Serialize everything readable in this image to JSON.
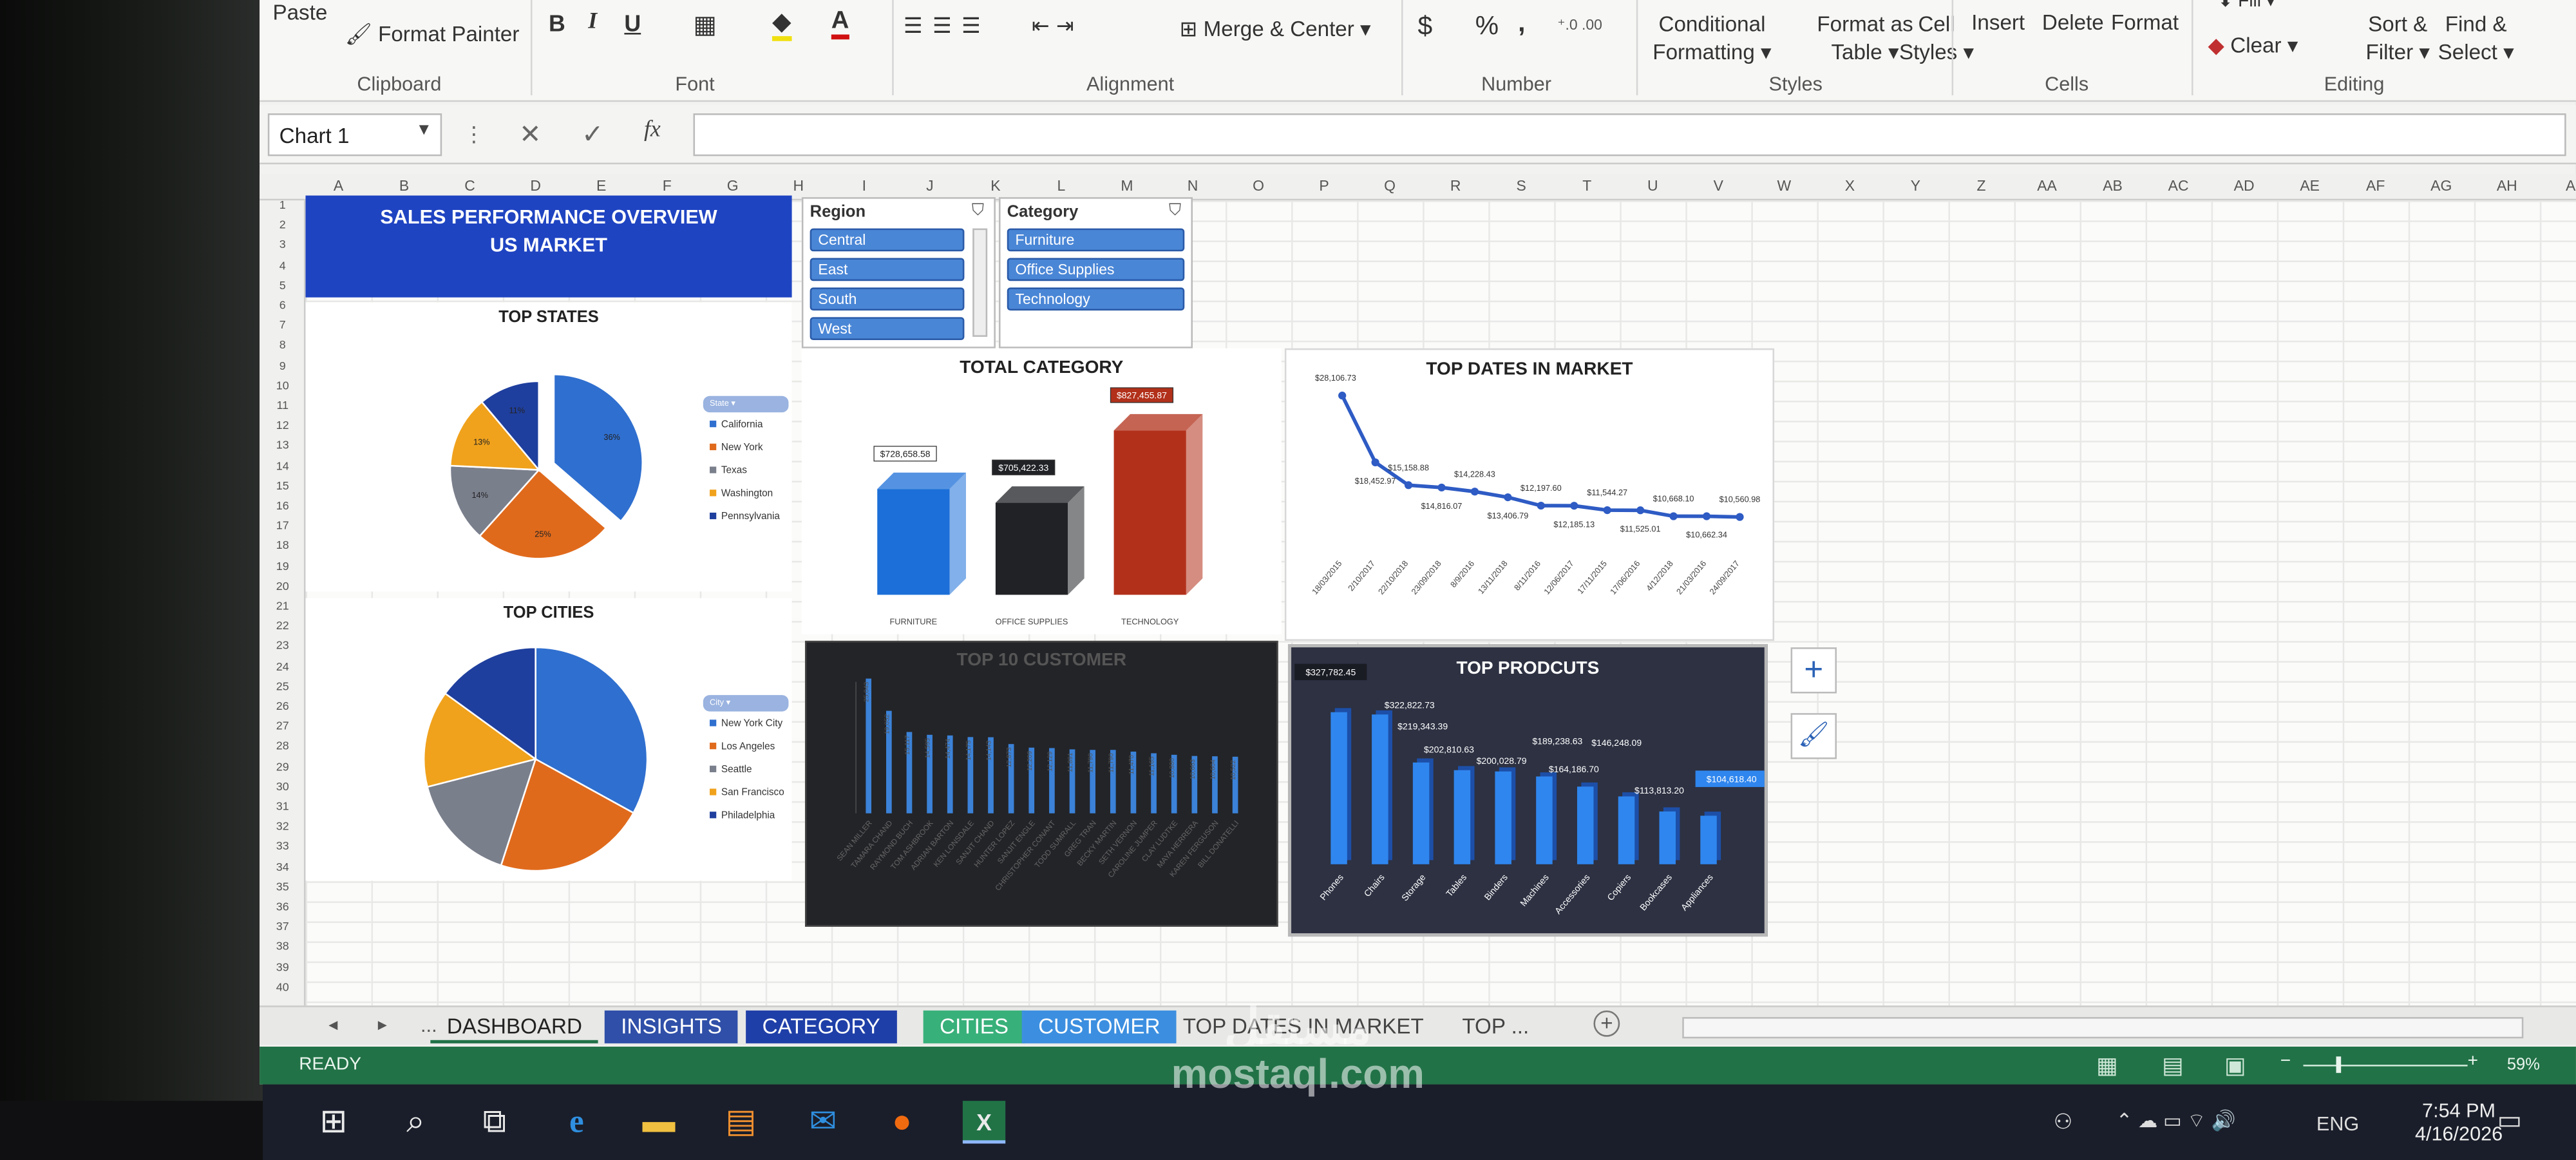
{
  "ribbon": {
    "paste": "Paste",
    "format_painter": "Format Painter",
    "clipboard": "Clipboard",
    "bold": "B",
    "italic": "I",
    "underline": "U",
    "font": "Font",
    "alignment": "Alignment",
    "merge_center": "Merge & Center",
    "currency": "$",
    "percent": "%",
    "comma": ",",
    "number": "Number",
    "cond_format_1": "Conditional",
    "cond_format_2": "Formatting",
    "format_table_1": "Format as",
    "format_table_2": "Table",
    "cell_styles_1": "Cell",
    "cell_styles_2": "Styles",
    "styles": "Styles",
    "insert": "Insert",
    "delete": "Delete",
    "format": "Format",
    "cells": "Cells",
    "fill": "Fill",
    "clear": "Clear",
    "sort_1": "Sort &",
    "sort_2": "Filter",
    "find_1": "Find &",
    "find_2": "Select",
    "editing": "Editing"
  },
  "formula_bar": {
    "name_box": "Chart 1",
    "fx": "fx"
  },
  "columns": [
    "A",
    "B",
    "C",
    "D",
    "E",
    "F",
    "G",
    "H",
    "I",
    "J",
    "K",
    "L",
    "M",
    "N",
    "O",
    "P",
    "Q",
    "R",
    "S",
    "T",
    "U",
    "V",
    "W",
    "X",
    "Y",
    "Z",
    "AA",
    "AB",
    "AC",
    "AD",
    "AE",
    "AF",
    "AG",
    "AH",
    "AI"
  ],
  "rows": [
    "1",
    "2",
    "3",
    "4",
    "5",
    "6",
    "7",
    "8",
    "9",
    "10",
    "11",
    "12",
    "13",
    "14",
    "15",
    "16",
    "17",
    "18",
    "19",
    "20",
    "21",
    "22",
    "23",
    "24",
    "25",
    "26",
    "27",
    "28",
    "29",
    "30",
    "31",
    "32",
    "33",
    "34",
    "35",
    "36",
    "37",
    "38",
    "39",
    "40"
  ],
  "dashboard": {
    "title_1": "SALES PERFORMANCE OVERVIEW",
    "title_2": "US MARKET",
    "region_slicer": {
      "title": "Region",
      "items": [
        "Central",
        "East",
        "South",
        "West"
      ]
    },
    "category_slicer": {
      "title": "Category",
      "items": [
        "Furniture",
        "Office Supplies",
        "Technology"
      ]
    },
    "states_legend_title": "State",
    "cities_legend_title": "City"
  },
  "chart_data": [
    {
      "id": "top-states",
      "type": "pie",
      "title": "TOP STATES",
      "categories": [
        "California",
        "New York",
        "Texas",
        "Washington",
        "Pennsylvania"
      ],
      "values": [
        36,
        25,
        14,
        13,
        11
      ],
      "data_labels": [
        "36%",
        "25%",
        "14%",
        "13%",
        "11%"
      ],
      "colors": [
        "#2f6fcf",
        "#e06a1c",
        "#7a7f8c",
        "#f0a21c",
        "#1f3f9e"
      ]
    },
    {
      "id": "top-cities",
      "type": "pie",
      "title": "TOP CITIES",
      "categories": [
        "New York City",
        "Los Angeles",
        "Seattle",
        "San Francisco",
        "Philadelphia"
      ],
      "values": [
        33,
        22,
        16,
        14,
        15
      ],
      "colors": [
        "#2f6fcf",
        "#e06a1c",
        "#7a7f8c",
        "#f0a21c",
        "#1f3f9e"
      ]
    },
    {
      "id": "total-category",
      "type": "bar",
      "title": "TOTAL CATEGORY",
      "categories": [
        "FURNITURE",
        "OFFICE SUPPLIES",
        "TECHNOLOGY"
      ],
      "values": [
        728658.58,
        705422.33,
        827455.87
      ],
      "data_labels": [
        "$728,658.58",
        "$705,422.33",
        "$827,455.87"
      ],
      "colors": [
        "#1c6fd8",
        "#202226",
        "#b2301a"
      ]
    },
    {
      "id": "top-dates",
      "type": "line",
      "title": "TOP DATES IN MARKET",
      "categories": [
        "18/03/2015",
        "2/10/2017",
        "22/10/2018",
        "23/09/2018",
        "8/9/2016",
        "13/11/2018",
        "8/11/2016",
        "12/06/2017",
        "17/11/2015",
        "17/06/2016",
        "4/12/2018",
        "21/03/2016",
        "24/09/2017"
      ],
      "values": [
        28106.73,
        18452.97,
        15158.88,
        14816.07,
        14228.43,
        13406.79,
        12197.6,
        12185.13,
        11544.27,
        11525.01,
        10668.1,
        10662.34,
        10560.98
      ],
      "data_labels": [
        "$28,106.73",
        "$18,452.97",
        "$15,158.88",
        "$14,816.07",
        "$14,228.43",
        "$13,406.79",
        "$12,197.60",
        "$12,185.13",
        "$11,544.27",
        "$11,525.01",
        "$10,668.10",
        "$10,662.34",
        "$10,560.98"
      ]
    },
    {
      "id": "top-customer",
      "type": "bar",
      "title": "TOP 10 CUSTOMER",
      "categories": [
        "SEAN MILLER",
        "TAMARA CHAND",
        "RAYMOND BUCH",
        "TOM ASHBROOK",
        "ADRIAN BARTON",
        "KEN LONSDALE",
        "SANJIT CHAND",
        "HUNTER LOPEZ",
        "SANJIT ENGLE",
        "CHRISTOPHER CONANT",
        "TODD SUMRALL",
        "GREG TRAN",
        "BECKY MARTIN",
        "SETH VERNON",
        "CAROLINE JUMPER",
        "CLAY LUDTKE",
        "MAYA HERRERA",
        "KAREN FERGUSON",
        "BILL DONATELLI"
      ],
      "values": [
        25043,
        19052,
        15117,
        14595,
        14474,
        14175,
        14143,
        12873,
        12209,
        12129,
        11891,
        11790,
        11790,
        11470,
        11165,
        10880,
        10663,
        10604,
        10522
      ]
    },
    {
      "id": "top-products",
      "type": "bar",
      "title": "TOP PRODCUTS",
      "categories": [
        "Phones",
        "Chairs",
        "Storage",
        "Tables",
        "Binders",
        "Machines",
        "Accessories",
        "Copiers",
        "Bookcases",
        "Appliances"
      ],
      "values": [
        327782.45,
        322822.73,
        219343.39,
        202810.63,
        200028.79,
        189238.63,
        167380.32,
        146248.09,
        113813.2,
        104618.4
      ],
      "data_labels": [
        "$327,782.45",
        "$322,822.73",
        "$219,343.39",
        "$202,810.63",
        "$200,028.79",
        "$189,238.63",
        "$164,186.70",
        "$146,248.09",
        "$113,813.20",
        "$104,618.40"
      ]
    }
  ],
  "tabs": [
    {
      "label": "DASHBOARD",
      "bg": "transparent",
      "fg": "#222"
    },
    {
      "label": "INSIGHTS",
      "bg": "#2f4fa8",
      "fg": "#fff"
    },
    {
      "label": "CATEGORY",
      "bg": "#1f3fa8",
      "fg": "#fff"
    },
    {
      "label": "CITIES",
      "bg": "#38b07a",
      "fg": "#fff"
    },
    {
      "label": "CUSTOMER",
      "bg": "#3c8fe0",
      "fg": "#fff"
    },
    {
      "label": "TOP DATES IN MARKET",
      "bg": "transparent",
      "fg": "#444"
    },
    {
      "label": "TOP ...",
      "bg": "transparent",
      "fg": "#444"
    }
  ],
  "tab_nav": {
    "prev": "◂",
    "next": "▸",
    "more": "...",
    "add": "+"
  },
  "status": {
    "ready": "READY",
    "zoom": "59%"
  },
  "taskbar": {
    "lang": "ENG",
    "time": "7:54 PM",
    "date": "4/16/2026"
  },
  "watermark": {
    "brand": "mostaql.com"
  }
}
